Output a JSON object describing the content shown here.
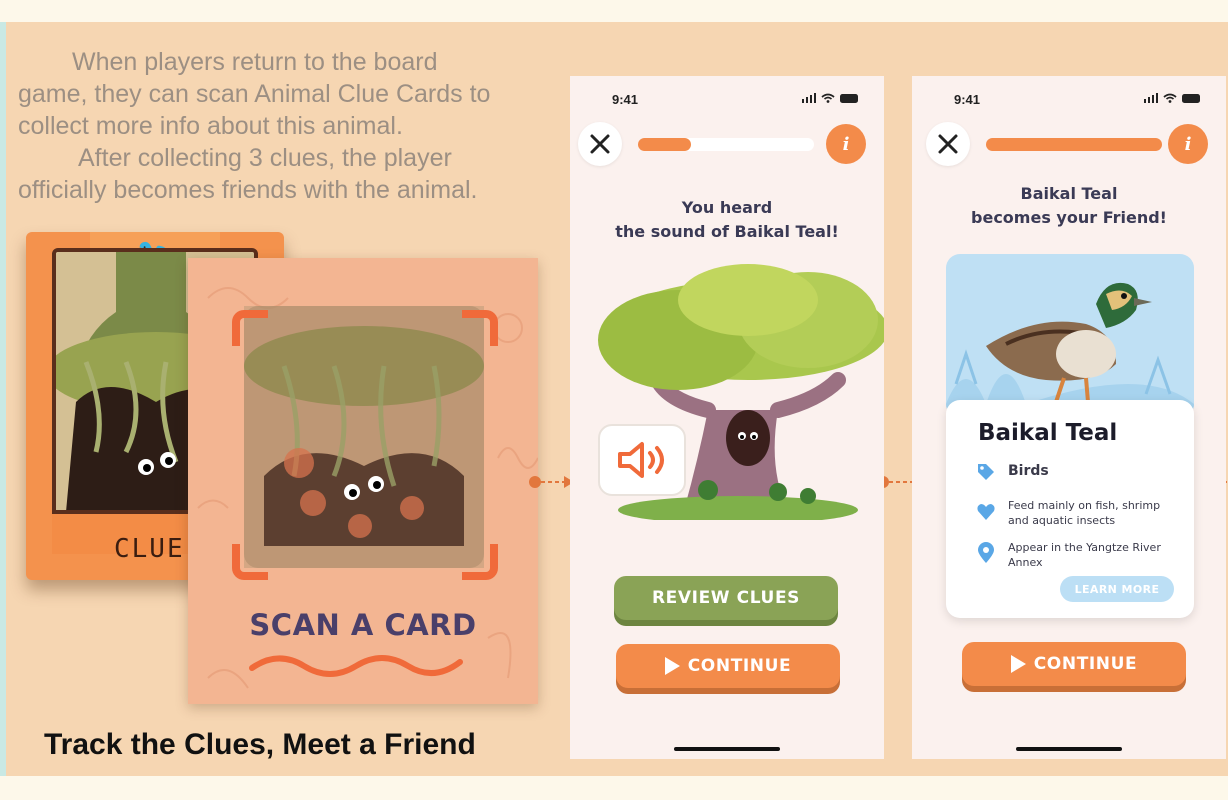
{
  "intro": {
    "line1": "When players return to the board",
    "line2": "game, they can scan Animal Clue Cards to",
    "line3": "collect more info about this animal.",
    "line4": "After collecting 3 clues, the player",
    "line5": "officially becomes friends with the animal."
  },
  "caption": "Track the Clues, Meet a Friend",
  "clue_card": {
    "label": "CLUE"
  },
  "scan_screen": {
    "title": "SCAN A CARD"
  },
  "screen1": {
    "time": "9:41",
    "progress": 0.3,
    "heading_line1": "You heard",
    "heading_line2": "the sound of Baikal Teal!",
    "review_button": "REVIEW CLUES",
    "continue_button": "CONTINUE"
  },
  "screen2": {
    "time": "9:41",
    "progress": 1.0,
    "heading_line1": "Baikal Teal",
    "heading_line2": "becomes your Friend!",
    "animal_name": "Baikal Teal",
    "category": "Birds",
    "diet": "Feed mainly on fish, shrimp and aquatic insects",
    "habitat": "Appear in the Yangtze River Annex",
    "learn_more": "LEARN MORE",
    "continue_button": "CONTINUE"
  },
  "colors": {
    "accent_orange": "#f38b4a",
    "button_green": "#8aa356",
    "panel_bg": "#f6d6b2",
    "heading_text": "#3a3a55",
    "info_blue": "#5aa7e6"
  },
  "icons": [
    "close-icon",
    "info-icon",
    "speaker-icon",
    "play-icon",
    "tag-icon",
    "heart-icon",
    "location-pin-icon",
    "signal-icon",
    "wifi-icon",
    "battery-icon"
  ]
}
